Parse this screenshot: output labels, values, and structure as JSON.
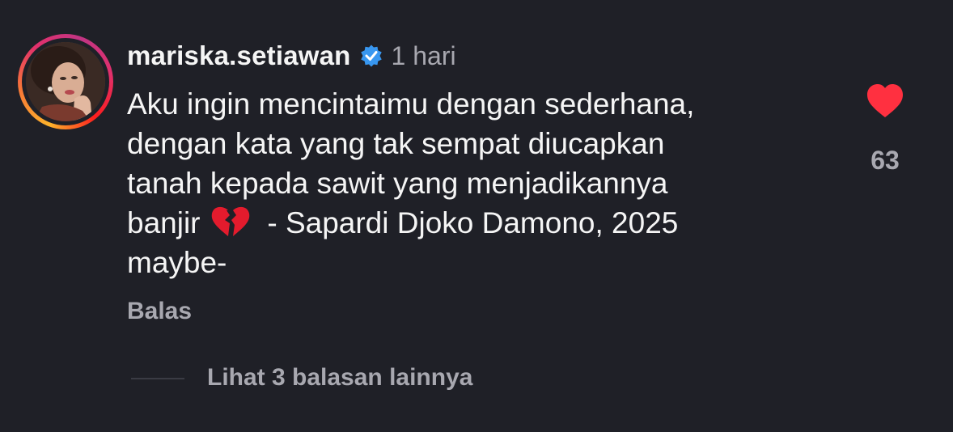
{
  "comment": {
    "username": "mariska.setiawan",
    "verified": true,
    "time": "1 hari",
    "lines": [
      "Aku ingin mencintaimu dengan sederhana,",
      "dengan kata yang tak sempat diucapkan",
      "tanah kepada sawit yang menjadikannya",
      "banjir",
      "  - Sapardi Djoko Damono, 2025",
      "maybe-"
    ],
    "emoji": "broken-heart-icon",
    "reply_label": "Balas",
    "view_more_label": "Lihat 3 balasan lainnya",
    "like_count": "63",
    "liked": true
  },
  "colors": {
    "background": "#1f2027",
    "text": "#f5f5f5",
    "secondary_text": "#a8a8b0",
    "like_red": "#ff3040",
    "verified_blue": "#3897f0"
  }
}
